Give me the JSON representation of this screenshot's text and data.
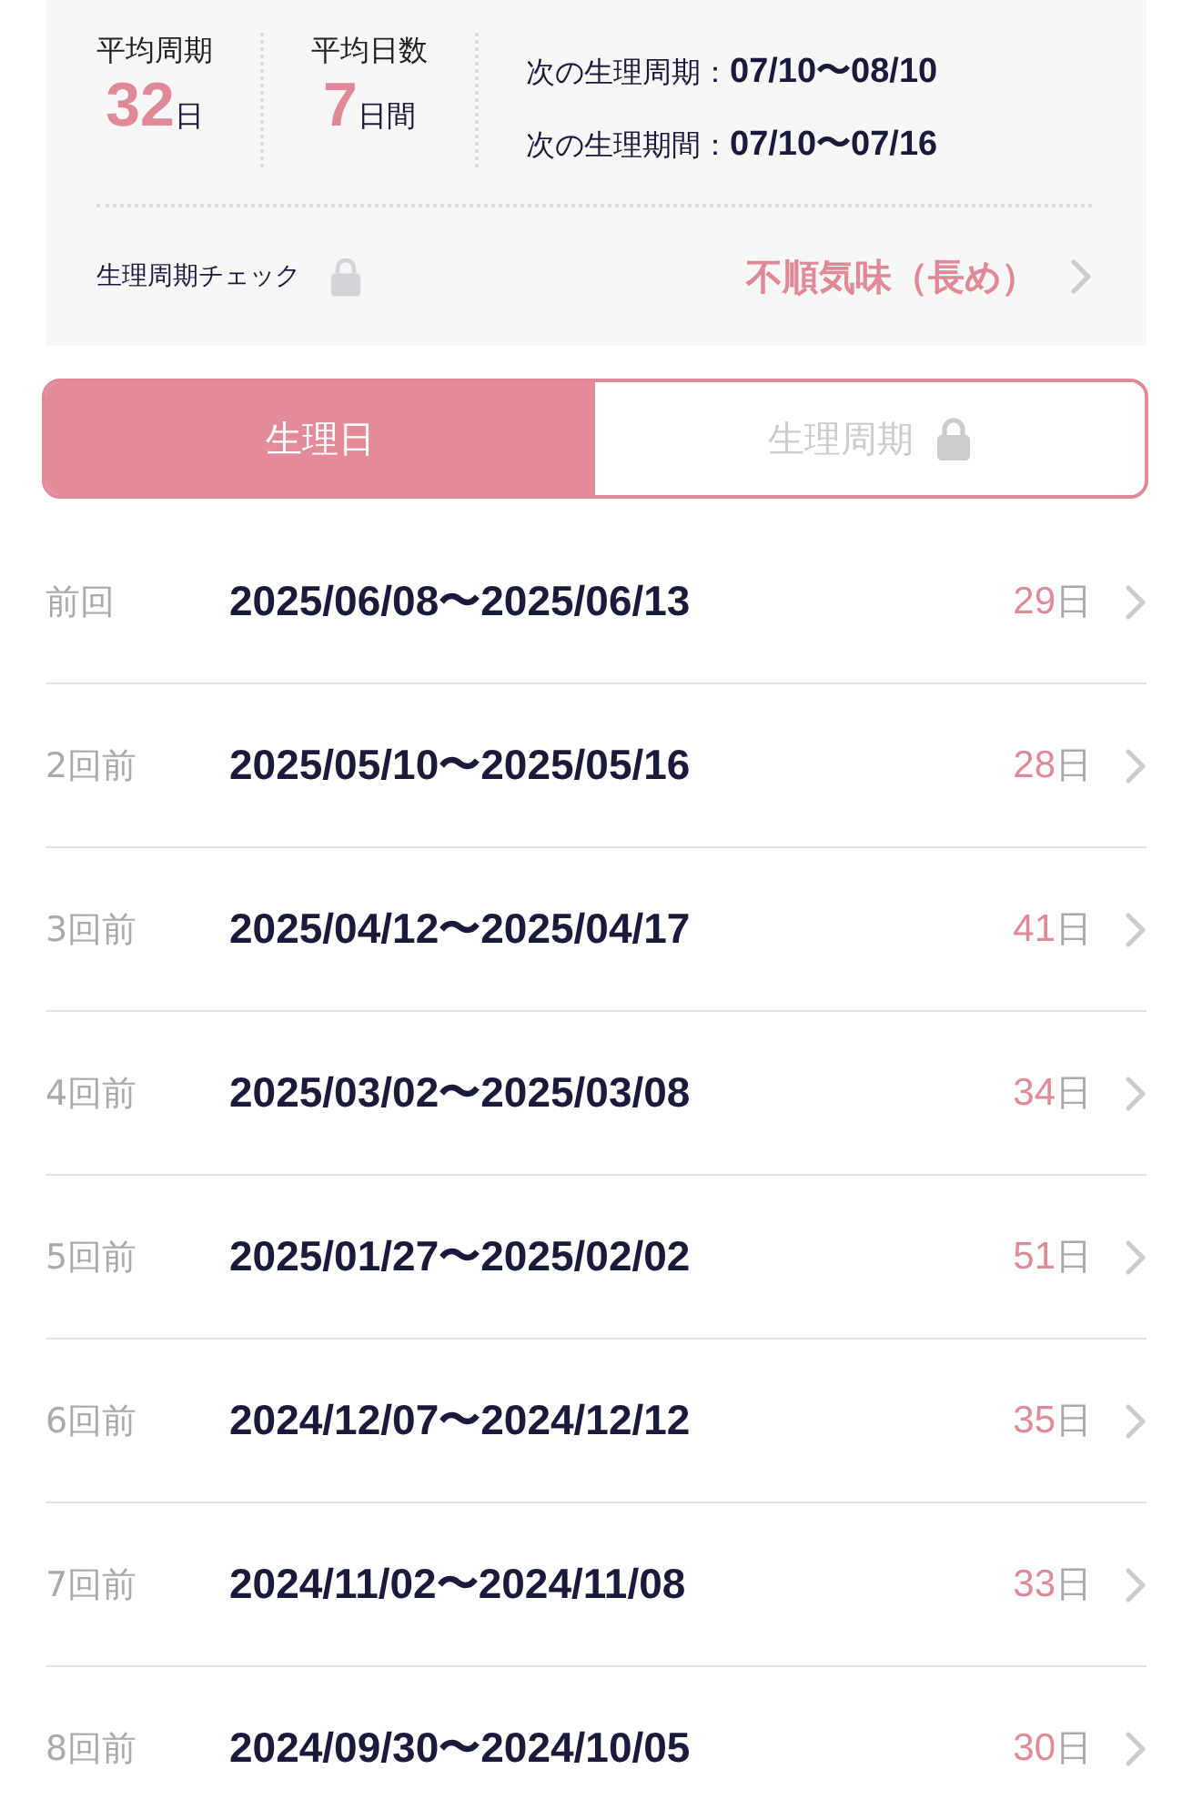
{
  "summary": {
    "stats": [
      {
        "label": "平均周期",
        "value": "32",
        "unit": "日"
      },
      {
        "label": "平均日数",
        "value": "7",
        "unit": "日間"
      }
    ],
    "next": [
      {
        "label": "次の生理周期：",
        "value": "07/10〜08/10"
      },
      {
        "label": "次の生理期間：",
        "value": "07/10〜07/16"
      }
    ],
    "check": {
      "label": "生理周期チェック",
      "locked": true,
      "result": "不順気味（長め）"
    }
  },
  "tabs": [
    {
      "label": "生理日",
      "selected": true,
      "locked": false
    },
    {
      "label": "生理周期",
      "selected": false,
      "locked": true
    }
  ],
  "history": [
    {
      "label": "前回",
      "range": "2025/06/08〜2025/06/13",
      "days": "29",
      "unit": "日"
    },
    {
      "label": "2回前",
      "range": "2025/05/10〜2025/05/16",
      "days": "28",
      "unit": "日"
    },
    {
      "label": "3回前",
      "range": "2025/04/12〜2025/04/17",
      "days": "41",
      "unit": "日"
    },
    {
      "label": "4回前",
      "range": "2025/03/02〜2025/03/08",
      "days": "34",
      "unit": "日"
    },
    {
      "label": "5回前",
      "range": "2025/01/27〜2025/02/02",
      "days": "51",
      "unit": "日"
    },
    {
      "label": "6回前",
      "range": "2024/12/07〜2024/12/12",
      "days": "35",
      "unit": "日"
    },
    {
      "label": "7回前",
      "range": "2024/11/02〜2024/11/08",
      "days": "33",
      "unit": "日"
    },
    {
      "label": "8回前",
      "range": "2024/09/30〜2024/10/05",
      "days": "30",
      "unit": "日"
    }
  ]
}
